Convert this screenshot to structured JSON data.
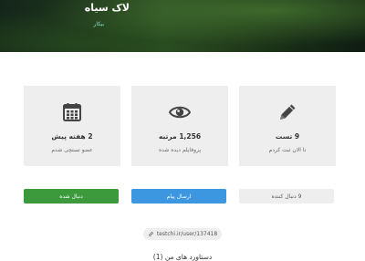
{
  "profile": {
    "name": "لاک سیاه",
    "status": "بیکار"
  },
  "stats": [
    {
      "value": "2 هفته پیش",
      "label": "عضو تستچی شدم",
      "icon": "calendar-icon"
    },
    {
      "value": "1,256 مرتبه",
      "label": "پروفایلم دیده شده",
      "icon": "eye-icon"
    },
    {
      "value": "9 تست",
      "label": "تا الان ثبت کردم",
      "icon": "pencil-icon"
    }
  ],
  "actions": {
    "follow_label": "دنبال شده",
    "message_label": "ارسال پیام",
    "followers_label": "9 دنبال کننده"
  },
  "profile_link": "testchi.ir/user/137418",
  "achievements_title": "دستاورد های من (1)",
  "colors": {
    "follow_button": "#3c9a3c",
    "message_button": "#3d96e0",
    "card_background": "#eeeeee",
    "status_text": "#8fe0d0"
  }
}
